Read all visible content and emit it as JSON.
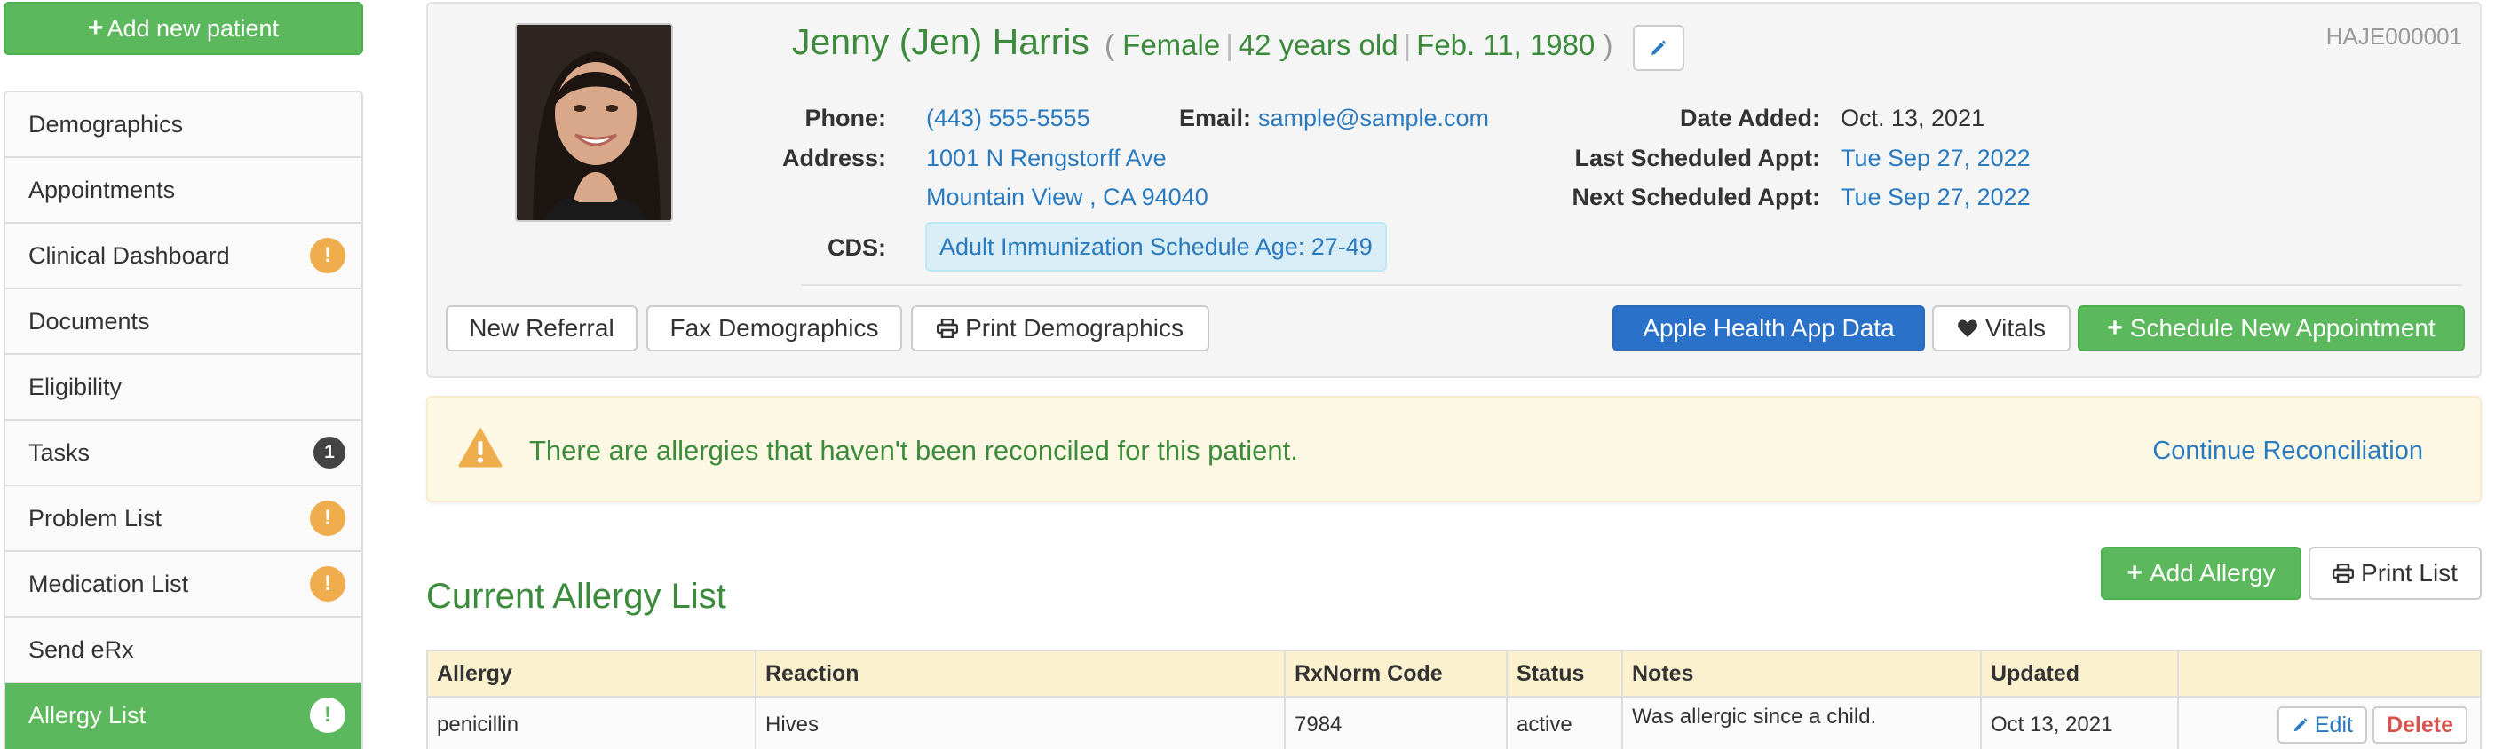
{
  "sidebar": {
    "add_button": "Add new patient",
    "items": [
      {
        "label": "Demographics",
        "badge": null
      },
      {
        "label": "Appointments",
        "badge": null
      },
      {
        "label": "Clinical Dashboard",
        "badge": "!"
      },
      {
        "label": "Documents",
        "badge": null
      },
      {
        "label": "Eligibility",
        "badge": null
      },
      {
        "label": "Tasks",
        "badge": "1"
      },
      {
        "label": "Problem List",
        "badge": "!"
      },
      {
        "label": "Medication List",
        "badge": "!"
      },
      {
        "label": "Send eRx",
        "badge": null
      },
      {
        "label": "Allergy List",
        "badge": "!",
        "active": true
      }
    ]
  },
  "patient": {
    "name": "Jenny (Jen) Harris",
    "gender": "Female",
    "age": "42 years old",
    "dob": "Feb. 11, 1980",
    "id": "HAJE000001",
    "phone_label": "Phone:",
    "phone": "(443) 555-5555",
    "email_label": "Email:",
    "email": "sample@sample.com",
    "address_label": "Address:",
    "address_line1": "1001 N Rengstorff Ave",
    "address_line2": "Mountain View , CA 94040",
    "cds_label": "CDS:",
    "cds": "Adult Immunization Schedule Age: 27-49",
    "date_added_label": "Date Added:",
    "date_added": "Oct. 13, 2021",
    "last_appt_label": "Last Scheduled Appt:",
    "last_appt": "Tue Sep 27, 2022",
    "next_appt_label": "Next Scheduled Appt:",
    "next_appt": "Tue Sep 27, 2022"
  },
  "actions": {
    "new_referral": "New Referral",
    "fax_demographics": "Fax Demographics",
    "print_demographics": "Print Demographics",
    "apple_health": "Apple Health App Data",
    "vitals": "Vitals",
    "schedule": "Schedule New Appointment"
  },
  "alert": {
    "text": "There are allergies that haven't been reconciled for this patient.",
    "link": "Continue Reconciliation"
  },
  "allergy": {
    "title": "Current Allergy List",
    "add_button": "Add Allergy",
    "print_button": "Print List",
    "columns": [
      "Allergy",
      "Reaction",
      "RxNorm Code",
      "Status",
      "Notes",
      "Updated",
      ""
    ],
    "rows": [
      {
        "allergy": "penicillin",
        "reaction": "Hives",
        "rxnorm": "7984",
        "status": "active",
        "notes": "Was allergic since a child.",
        "updated": "Oct 13, 2021"
      }
    ],
    "edit_label": "Edit",
    "delete_label": "Delete"
  },
  "colors": {
    "success": "#5cb85c",
    "primary": "#2a72c9",
    "link": "#2a7ac0",
    "heading_green": "#3c8b3c",
    "warning": "#f0ad4e",
    "danger": "#d9534f"
  }
}
